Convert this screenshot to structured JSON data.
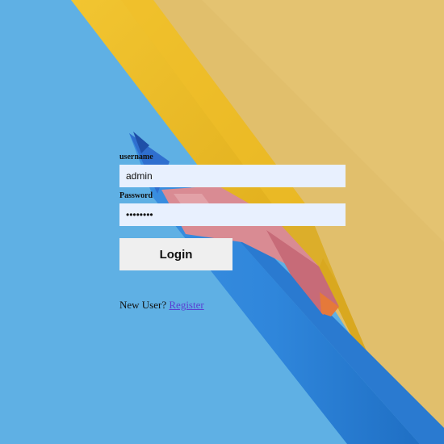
{
  "background": {
    "sky_color": "#5fb0e4",
    "paper_color": "#e1bf6c",
    "pencils": [
      "yellow-pencil",
      "blue-pencil",
      "red-pencil"
    ]
  },
  "login": {
    "username_label": "username",
    "username_value": "admin",
    "password_label": "Password",
    "password_value": "12345678",
    "login_button": "Login"
  },
  "register": {
    "prompt": "New User?",
    "link_label": "Register"
  }
}
